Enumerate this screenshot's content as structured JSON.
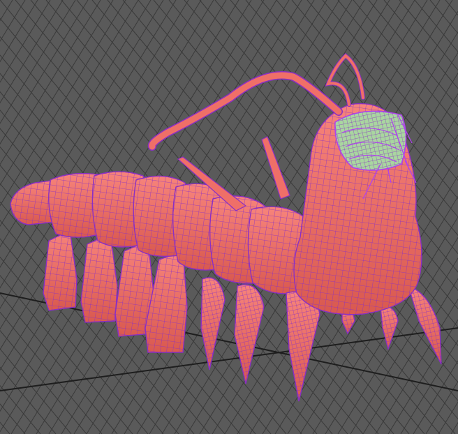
{
  "viewport": {
    "background_color": "#5a5a5a",
    "grid_color": "#3a3a3a",
    "grid_axis_color": "#1e1e1e",
    "grid_visible": true
  },
  "model": {
    "body_color": "#ef6f68",
    "body_shadow_color": "#c45048",
    "wireframe_color": "#8a2fc4",
    "selected_wireframe_color": "#b040f0",
    "eye_patch_color": "#a9d6a0",
    "shaded_with_wireframe": true
  }
}
